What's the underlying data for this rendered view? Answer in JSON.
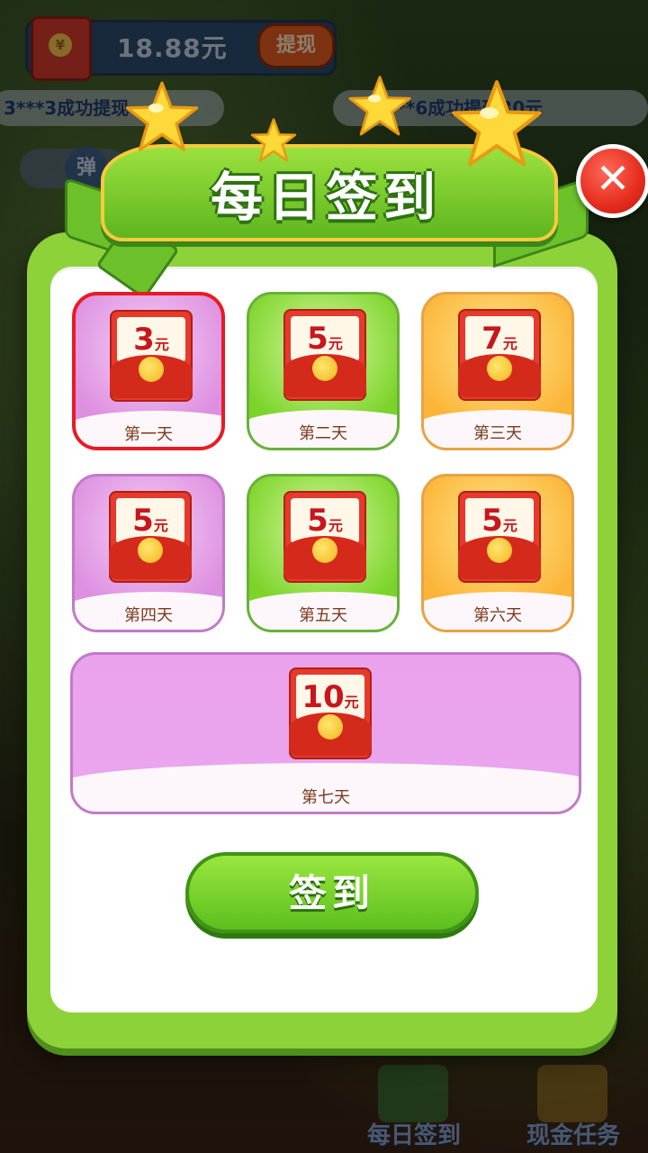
{
  "header": {
    "balance": "18.88元",
    "withdraw_label": "提现",
    "ticker_left": "3***3成功提现",
    "ticker_right": "***6成功提现30元",
    "bullet_label": "弹"
  },
  "bottom_nav": {
    "daily_signin": "每日签到",
    "cash_tasks": "现金任务"
  },
  "dialog": {
    "title": "每日签到",
    "close_label": "✕",
    "unit": "元",
    "days": [
      {
        "label": "第一天",
        "amount": "3",
        "theme": "purple",
        "selected": true
      },
      {
        "label": "第二天",
        "amount": "5",
        "theme": "green",
        "selected": false
      },
      {
        "label": "第三天",
        "amount": "7",
        "theme": "orange",
        "selected": false
      },
      {
        "label": "第四天",
        "amount": "5",
        "theme": "purple",
        "selected": false
      },
      {
        "label": "第五天",
        "amount": "5",
        "theme": "green",
        "selected": false
      },
      {
        "label": "第六天",
        "amount": "5",
        "theme": "orange",
        "selected": false
      },
      {
        "label": "第七天",
        "amount": "10",
        "theme": "purple",
        "selected": false
      }
    ],
    "signin_button": "签到"
  },
  "colors": {
    "dialog_green": "#8ed23a",
    "selected_border": "#e81b23",
    "envelope_red": "#e53a2c"
  }
}
